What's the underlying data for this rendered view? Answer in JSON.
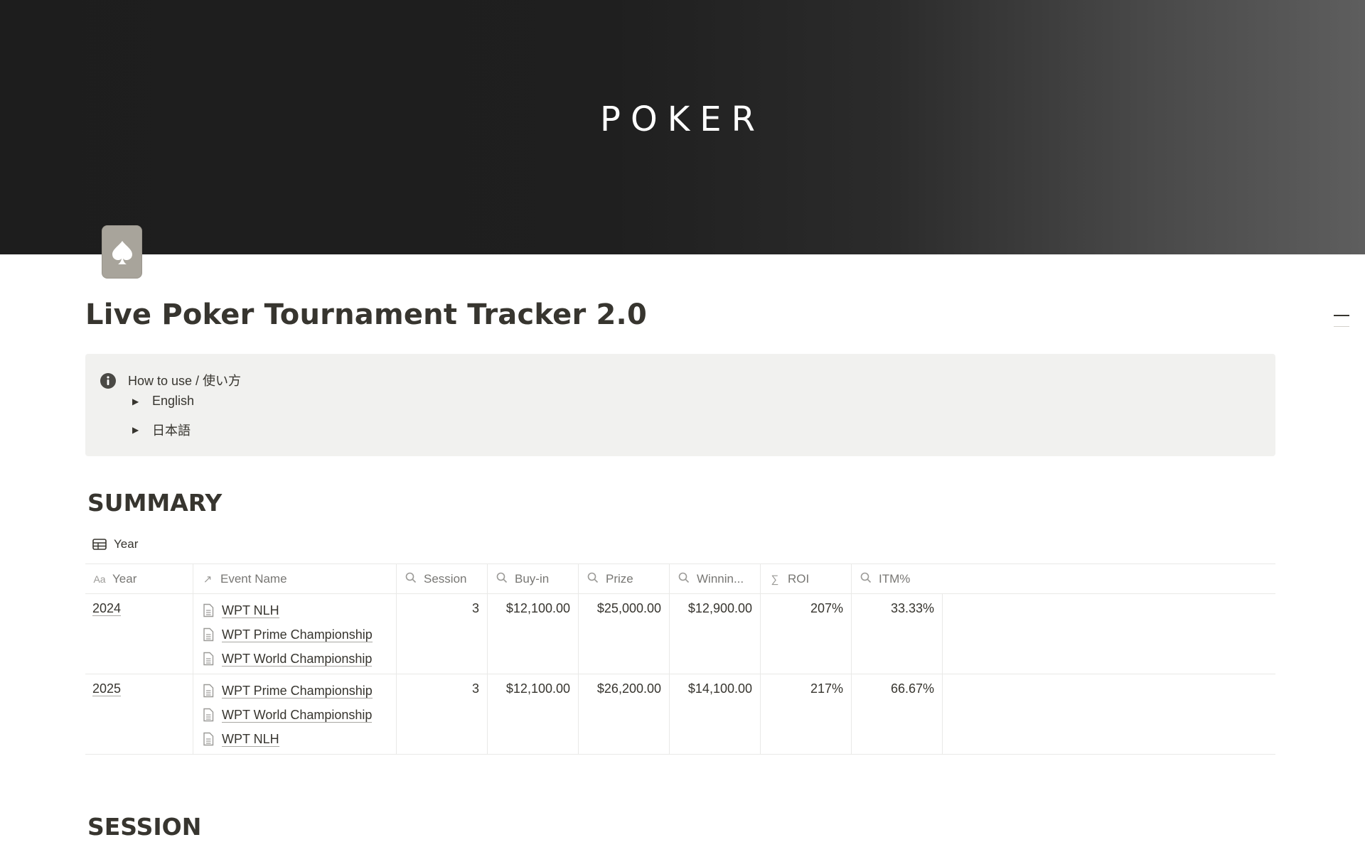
{
  "cover": {
    "title": "POKER"
  },
  "page": {
    "title": "Live Poker Tournament Tracker 2.0",
    "icon": "spade-icon"
  },
  "callout": {
    "icon": "info-icon",
    "title": "How to use / 使い方",
    "toggles": [
      {
        "label": "English"
      },
      {
        "label": "日本語"
      }
    ]
  },
  "summary": {
    "heading": "SUMMARY",
    "view": {
      "label": "Year",
      "icon": "table-icon"
    },
    "columns": [
      {
        "label": "Year",
        "icon": "Aa"
      },
      {
        "label": "Event Name",
        "icon": "↗"
      },
      {
        "label": "Session",
        "icon": "search-icon"
      },
      {
        "label": "Buy-in",
        "icon": "search-icon"
      },
      {
        "label": "Prize",
        "icon": "search-icon"
      },
      {
        "label": "Winnin...",
        "icon": "search-icon"
      },
      {
        "label": "ROI",
        "icon": "∑"
      },
      {
        "label": "ITM%",
        "icon": "search-icon"
      }
    ],
    "rows": [
      {
        "year": "2024",
        "events": [
          "WPT NLH",
          "WPT Prime Championship",
          "WPT World Championship"
        ],
        "session": "3",
        "buyin": "$12,100.00",
        "prize": "$25,000.00",
        "winnings": "$12,900.00",
        "roi": "207%",
        "itm": "33.33%"
      },
      {
        "year": "2025",
        "events": [
          "WPT Prime Championship",
          "WPT World Championship",
          "WPT NLH"
        ],
        "session": "3",
        "buyin": "$12,100.00",
        "prize": "$26,200.00",
        "winnings": "$14,100.00",
        "roi": "217%",
        "itm": "66.67%"
      }
    ]
  },
  "session": {
    "heading": "SESSION"
  }
}
